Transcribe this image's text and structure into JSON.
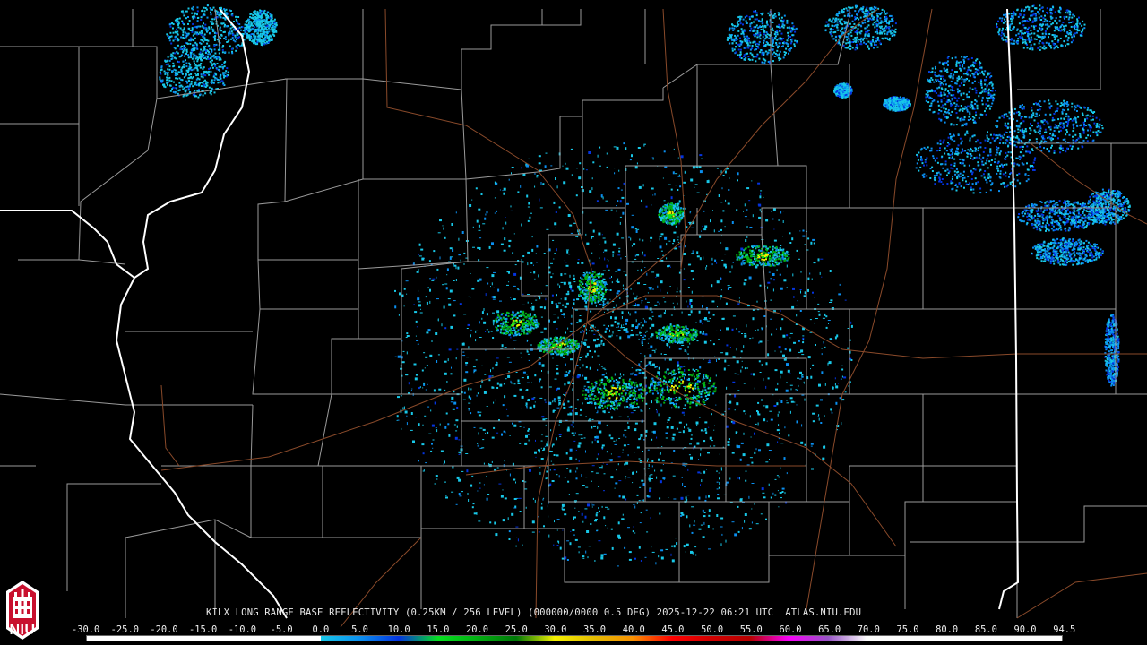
{
  "caption": "KILX LONG RANGE BASE REFLECTIVITY (0.25KM / 256 LEVEL) (000000/0000 0.5 DEG) 2025-12-22 06:21 UTC  ATLAS.NIU.EDU",
  "logo": {
    "text": "NIU",
    "color": "#c8102e"
  },
  "scale": {
    "labels": [
      "-30.0",
      "-25.0",
      "-20.0",
      "-15.0",
      "-10.0",
      "-5.0",
      "0.0",
      "5.0",
      "10.0",
      "15.0",
      "20.0",
      "25.0",
      "30.0",
      "35.0",
      "40.0",
      "45.0",
      "50.0",
      "55.0",
      "60.0",
      "65.0",
      "70.0",
      "75.0",
      "80.0",
      "85.0",
      "90.0",
      "94.5"
    ],
    "colors": [
      "#000000",
      "#000000",
      "#000000",
      "#000000",
      "#000000",
      "#000000",
      "#18c8e8",
      "#0a8ff0",
      "#0434e0",
      "#06e020",
      "#02b012",
      "#007808",
      "#f4f000",
      "#e4bc00",
      "#f89000",
      "#ff0000",
      "#d20000",
      "#b80000",
      "#f800f8",
      "#9854c6",
      "#fcfcfc",
      "#fcfcfc",
      "#fcfcfc",
      "#fcfcfc",
      "#fcfcfc"
    ]
  },
  "radar": {
    "site": "KILX",
    "colors": {
      "light": "#18c8e8",
      "medium": "#0a8ff0",
      "strong": "#0434e0",
      "green": "#06e020",
      "darkgreen": "#02b012",
      "yellow": "#f4f000"
    },
    "map_colors": {
      "county": "#9a9a9a",
      "state": "#ffffff",
      "road": "#8a4a2a"
    }
  }
}
